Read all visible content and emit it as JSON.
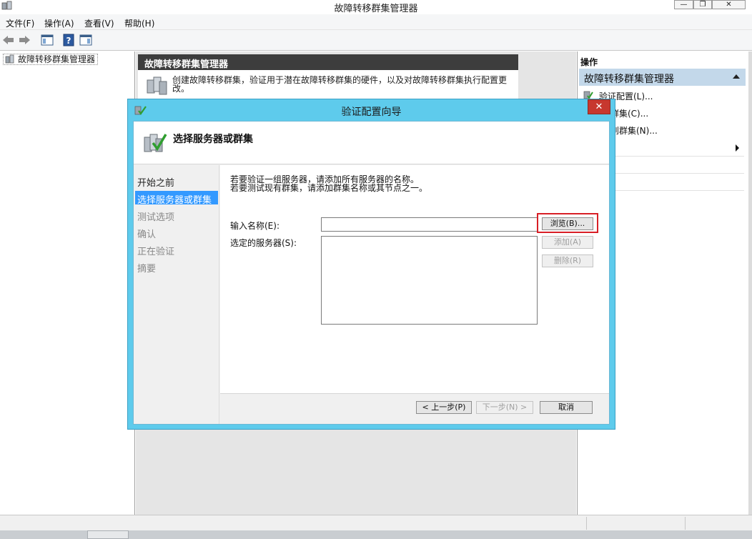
{
  "window": {
    "title": "故障转移群集管理器",
    "minimize": "—",
    "restore": "❐",
    "close": "✕"
  },
  "menu": [
    "文件(F)",
    "操作(A)",
    "查看(V)",
    "帮助(H)"
  ],
  "tree": {
    "root": "故障转移群集管理器"
  },
  "content": {
    "header": "故障转移群集管理器",
    "description": "创建故障转移群集，验证用于潜在故障转移群集的硬件，以及对故障转移群集执行配置更改。"
  },
  "actions": {
    "title": "操作",
    "group": "故障转移群集管理器",
    "items": [
      "验证配置(L)...",
      "群集(C)...",
      "到群集(N)...",
      "",
      "",
      "",
      ""
    ]
  },
  "wizard": {
    "title": "验证配置向导",
    "close": "✕",
    "header": "选择服务器或群集",
    "steps": [
      "开始之前",
      "选择服务器或群集",
      "测试选项",
      "确认",
      "正在验证",
      "摘要"
    ],
    "active_step": 1,
    "intro_line1": "若要验证一组服务器，请添加所有服务器的名称。",
    "intro_line2": "若要测试现有群集，请添加群集名称或其节点之一。",
    "name_label": "输入名称(E):",
    "name_value": "",
    "servers_label": "选定的服务器(S):",
    "browse_button": "浏览(B)...",
    "add_button": "添加(A)",
    "remove_button": "删除(R)",
    "prev_button": "< 上一步(P)",
    "next_button": "下一步(N) >",
    "cancel_button": "取消"
  }
}
